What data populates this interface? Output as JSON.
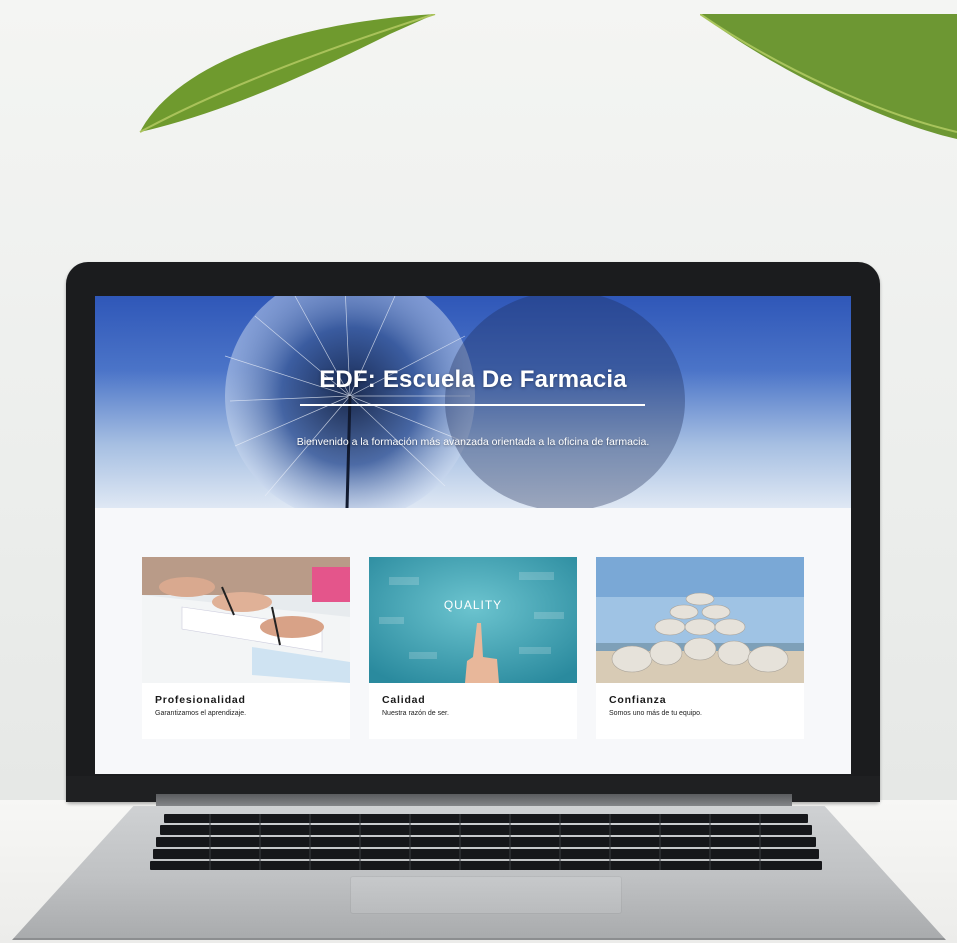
{
  "site": {
    "hero": {
      "title": "EDF: Escuela De Farmacia",
      "subtitle": "Bienvenido a la formación más avanzada orientada a la oficina de farmacia."
    },
    "cards": [
      {
        "title": "Profesionalidad",
        "description": "Garantizamos el aprendizaje.",
        "image": "students-writing-image"
      },
      {
        "title": "Calidad",
        "description": "Nuestra razón de ser.",
        "image": "quality-touch-image"
      },
      {
        "title": "Confianza",
        "description": "Somos uno más de tu equipo.",
        "image": "stacked-stones-image"
      }
    ],
    "quality_image_text": "QUALITY"
  },
  "colors": {
    "hero_blue": "#2f57b8",
    "card_bg": "#ffffff",
    "quality_teal": "#3aa6b6"
  }
}
